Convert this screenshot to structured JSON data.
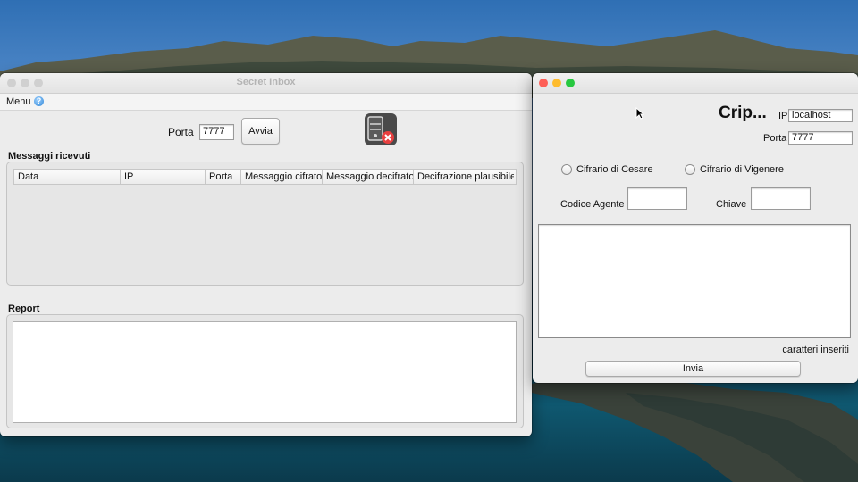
{
  "inbox_window": {
    "title": "Secret Inbox",
    "menu": {
      "menu_label": "Menu",
      "help_icon": "help-icon"
    },
    "server": {
      "port_label": "Porta",
      "port_value": "7777",
      "start_button": "Avvia",
      "status_icon": "server-stopped-icon"
    },
    "messages": {
      "section_label": "Messaggi ricevuti",
      "columns": [
        "Data",
        "IP",
        "Porta",
        "Messaggio cifrato",
        "Messaggio decifrato",
        "Decifrazione plausibile"
      ],
      "rows": []
    },
    "report": {
      "section_label": "Report",
      "content": ""
    }
  },
  "client_window": {
    "title_text": "Crip...",
    "ip_label": "IP",
    "ip_value": "localhost",
    "port_label": "Porta",
    "port_value": "7777",
    "cipher_options": [
      {
        "label": "Cifrario di Cesare",
        "selected": false
      },
      {
        "label": "Cifrario di Vigenere",
        "selected": false
      }
    ],
    "agent_code_label": "Codice Agente",
    "agent_code_value": "",
    "key_label": "Chiave",
    "key_value": "",
    "message_value": "",
    "chars_label": "caratteri inseriti",
    "send_button": "Invia"
  },
  "colors": {
    "close": "#fe5f57",
    "minimize": "#febc2e",
    "zoom": "#28c840",
    "inactive_light": "#d0d0d0"
  }
}
